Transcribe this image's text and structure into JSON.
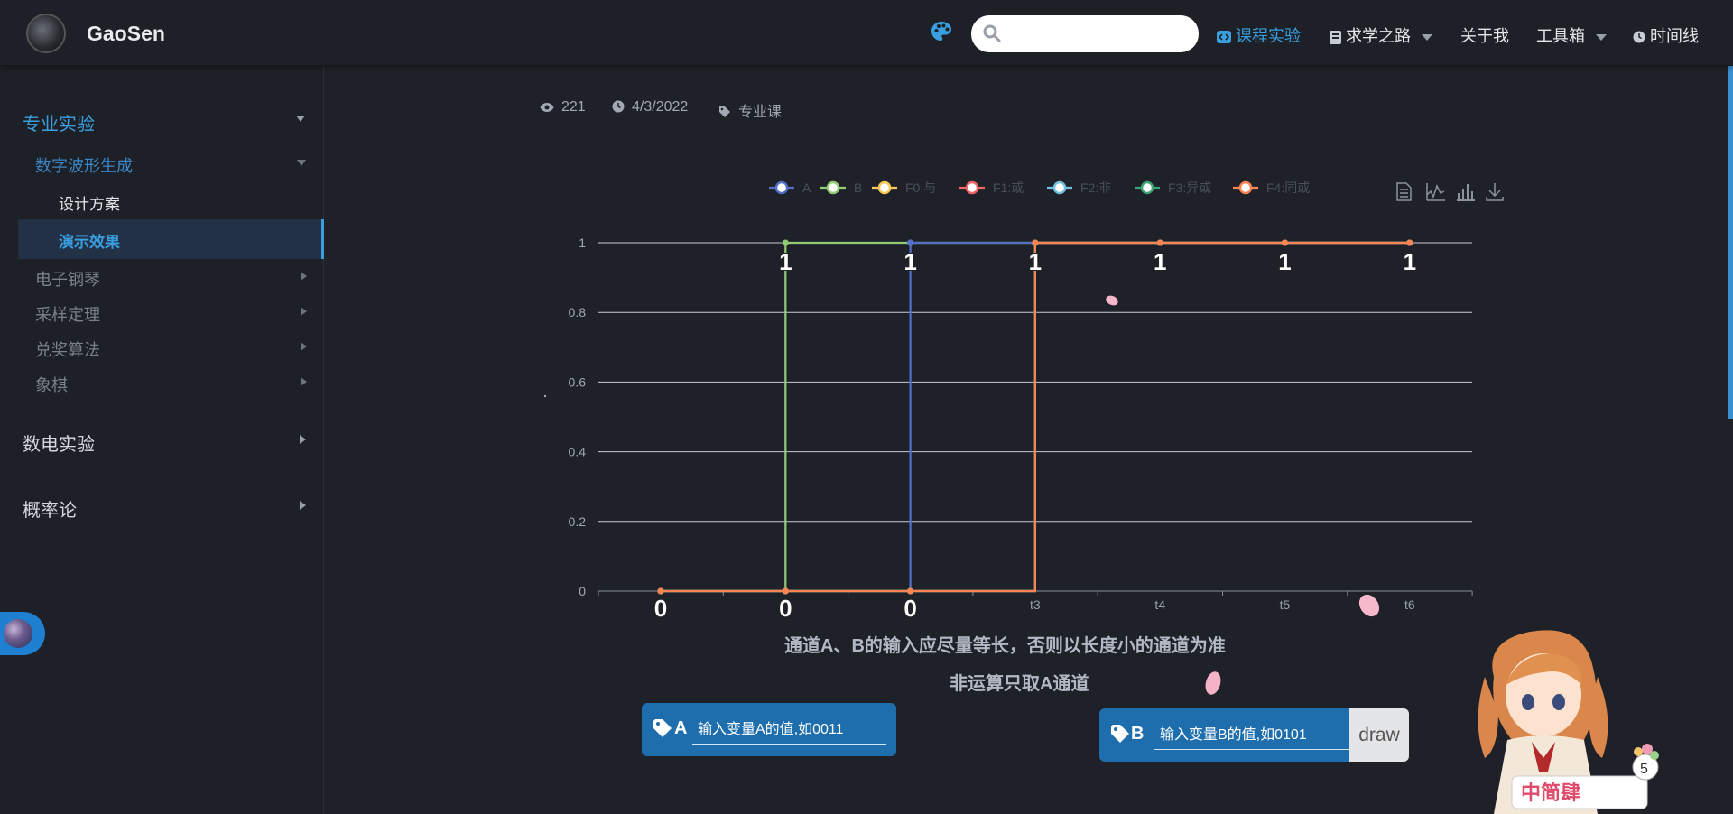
{
  "site": {
    "brand": "GaoSen"
  },
  "header": {
    "search": {
      "placeholder": ""
    },
    "nav": [
      {
        "label": "课程实验",
        "icon": "code-icon",
        "active": true
      },
      {
        "label": "求学之路",
        "icon": "book-icon",
        "dropdown": true
      },
      {
        "label": "关于我"
      },
      {
        "label": "工具箱",
        "dropdown": true
      },
      {
        "label": "时间线",
        "icon": "clock-icon"
      }
    ]
  },
  "sidebar": {
    "sections": [
      {
        "label": "专业实验",
        "expanded": true
      },
      {
        "label": "数电实验",
        "expanded": false
      },
      {
        "label": "概率论",
        "expanded": false
      }
    ],
    "sub_items": [
      {
        "label": "数字波形生成",
        "expanded": true
      },
      {
        "label": "电子钢琴"
      },
      {
        "label": "采样定理"
      },
      {
        "label": "兑奖算法"
      },
      {
        "label": "象棋"
      }
    ],
    "leaves": [
      {
        "label": "设计方案"
      },
      {
        "label": "演示效果",
        "active": true
      }
    ]
  },
  "meta": {
    "views": "221",
    "date": "4/3/2022",
    "category": "专业课"
  },
  "chart_data": {
    "type": "line",
    "step": true,
    "categories": [
      "",
      "",
      "",
      "t3",
      "t4",
      "t5",
      "t6"
    ],
    "series": [
      {
        "name": "A",
        "color": "#5470c6",
        "values": [
          0,
          0,
          1,
          1,
          1,
          1,
          1
        ]
      },
      {
        "name": "B",
        "color": "#91cc75",
        "values": [
          0,
          1,
          1,
          1,
          1,
          1,
          1
        ]
      },
      {
        "name": "F0:与",
        "color": "#fac858",
        "values": [
          0,
          0,
          0,
          1,
          1,
          1,
          1
        ]
      },
      {
        "name": "F1:或",
        "color": "#ee6666",
        "values": [
          0,
          0,
          0,
          1,
          1,
          1,
          1
        ]
      },
      {
        "name": "F2:非",
        "color": "#73c0de",
        "values": [
          0,
          0,
          0,
          1,
          1,
          1,
          1
        ]
      },
      {
        "name": "F3:异或",
        "color": "#3ba272",
        "values": [
          0,
          0,
          0,
          1,
          1,
          1,
          1
        ]
      },
      {
        "name": "F4:同或",
        "color": "#fc8452",
        "values": [
          0,
          0,
          0,
          1,
          1,
          1,
          1
        ]
      }
    ],
    "point_labels": [
      "0",
      "0",
      "0",
      "1",
      "1",
      "1",
      "1",
      "1",
      "1"
    ],
    "ylim": [
      0,
      1
    ],
    "yticks": [
      "0",
      "0.2",
      "0.4",
      "0.6",
      "0.8",
      "1"
    ],
    "grid": true,
    "legend_position": "top",
    "toolbox": [
      "data-view-icon",
      "line-chart-icon",
      "bar-chart-icon",
      "download-icon"
    ]
  },
  "notes": {
    "line1": "通道A、B的输入应尽量等长，否则以长度小的通道为准",
    "line2": "非运算只取A通道"
  },
  "inputs": {
    "a": {
      "label": "A",
      "placeholder": "输入变量A的值,如0011"
    },
    "b": {
      "label": "B",
      "placeholder": "输入变量B的值,如0101"
    },
    "draw_label": "draw"
  },
  "mascot": {
    "sign": "中简肆",
    "badge": "5"
  },
  "colors": {
    "accent": "#3a9fe0",
    "input_bg": "#1e6eae",
    "background": "#1e2128"
  }
}
